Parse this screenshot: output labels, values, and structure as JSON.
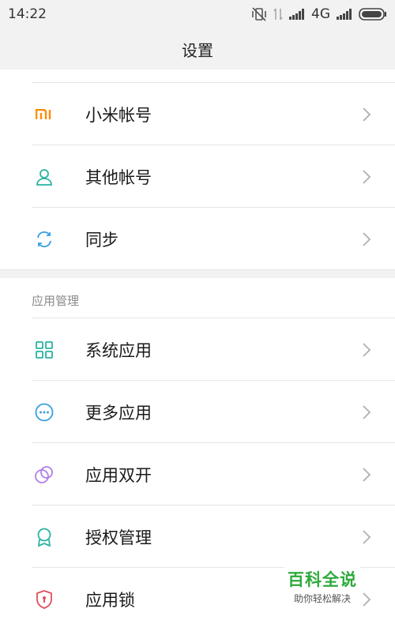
{
  "status": {
    "time": "14:22",
    "network": "4G"
  },
  "header": {
    "title": "设置"
  },
  "accounts": {
    "items": [
      {
        "label": "小米帐号",
        "icon": "mi-logo-icon"
      },
      {
        "label": "其他帐号",
        "icon": "user-icon"
      },
      {
        "label": "同步",
        "icon": "sync-icon"
      }
    ]
  },
  "apps": {
    "section_title": "应用管理",
    "items": [
      {
        "label": "系统应用",
        "icon": "grid-icon"
      },
      {
        "label": "更多应用",
        "icon": "more-icon"
      },
      {
        "label": "应用双开",
        "icon": "dual-app-icon"
      },
      {
        "label": "授权管理",
        "icon": "badge-icon"
      },
      {
        "label": "应用锁",
        "icon": "shield-lock-icon"
      }
    ]
  },
  "watermark": {
    "title": "百科全说",
    "subtitle": "助你轻松解决"
  },
  "colors": {
    "mi": "#ff8a00",
    "teal": "#2bb3a0",
    "blue": "#3aa0e0",
    "purple": "#b07fe8",
    "red": "#e0505a"
  }
}
